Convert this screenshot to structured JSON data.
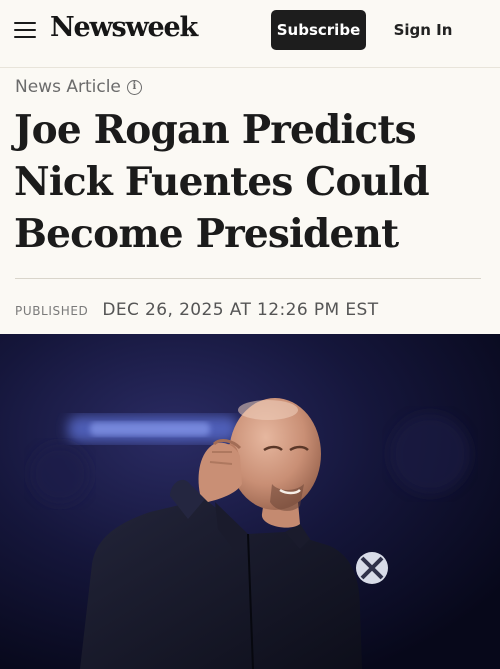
{
  "header": {
    "logo": "Newsweek",
    "subscribe_label": "Subscribe",
    "signin_label": "Sign In"
  },
  "article": {
    "type_label": "News Article",
    "headline": "Joe Rogan Predicts Nick Fuentes Could Become President",
    "published_label": "PUBLISHED",
    "published_date": "DEC 26, 2025 AT 12:26 PM EST"
  },
  "colors": {
    "background": "#fbf9f4",
    "subscribe_bg": "#1d1d1d",
    "text_primary": "#1b1b1b",
    "text_muted": "#6b6b6b"
  },
  "icons": [
    "hamburger-menu-icon",
    "info-icon"
  ]
}
